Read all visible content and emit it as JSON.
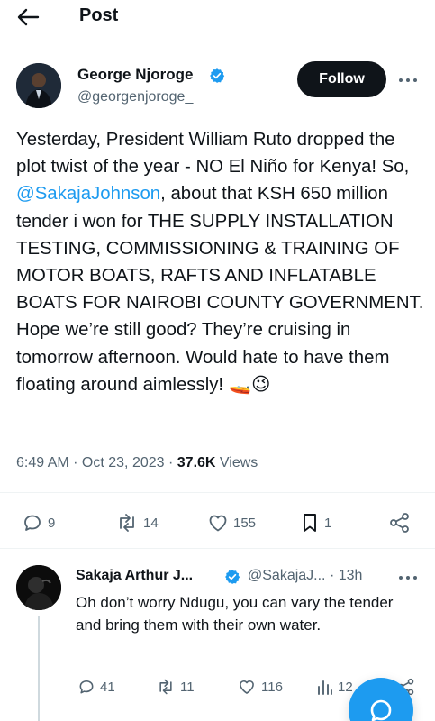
{
  "header": {
    "title": "Post"
  },
  "tweet": {
    "author_name": "George Njoroge",
    "author_handle": "@georgenjoroge_",
    "follow_label": "Follow",
    "body_before_mention": "Yesterday, President William Ruto dropped the plot twist of the year - NO El Niño for Kenya! So, ",
    "mention": "@SakajaJohnson",
    "body_after_mention": ", about that KSH 650 million tender i won for THE SUPPLY INSTALLATION TESTING, COMMISSIONING & TRAINING OF MOTOR BOATS, RAFTS AND INFLATABLE BOATS FOR NAIROBI COUNTY GOVERNMENT. Hope we’re still good? They’re cruising in tomorrow afternoon. Would hate to have them floating around aimlessly! ",
    "emoji": "🚤😉",
    "timestamp": "6:49 AM · Oct 23, 2023 · ",
    "views_count": "37.6K",
    "views_label": " Views",
    "stats": {
      "replies": "9",
      "reposts": "14",
      "likes": "155",
      "bookmarks": "1"
    }
  },
  "reply": {
    "author_name": "Sakaja Arthur J...",
    "author_handle": "@SakajaJ... · 13h",
    "body": "Oh don’t worry Ndugu, you can vary the tender and bring them with their own water.",
    "stats": {
      "replies": "41",
      "reposts": "11",
      "likes": "116",
      "views": "12"
    }
  },
  "colors": {
    "accent": "#1d9bf0",
    "verified": "#1d9bf0",
    "text": "#0f1419",
    "muted": "#536471"
  }
}
